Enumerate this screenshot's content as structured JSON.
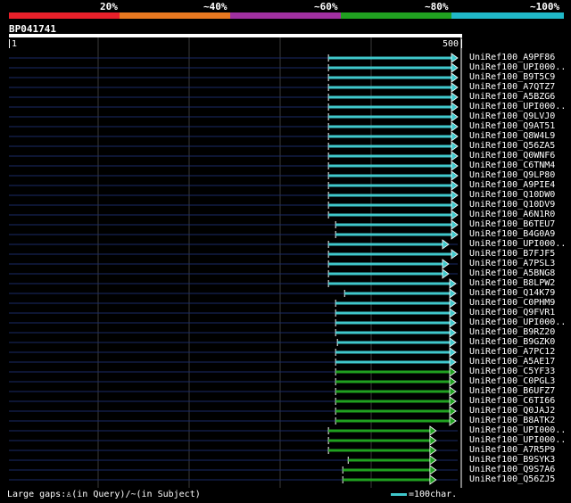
{
  "legend": {
    "labels": [
      "20%",
      "~40%",
      "~60%",
      "~80%",
      "~100%"
    ],
    "colors": [
      "#e8202a",
      "#e87820",
      "#a030a0",
      "#20a020",
      "#20b8c8"
    ]
  },
  "query": {
    "name": "BP041741",
    "start_label": "1",
    "end_label": "500"
  },
  "hits": [
    {
      "label": "UniRef100_A9PF86",
      "start": 356,
      "end": 500,
      "color": "#40c8cc"
    },
    {
      "label": "UniRef100_UPI000..",
      "start": 356,
      "end": 500,
      "color": "#40c8cc"
    },
    {
      "label": "UniRef100_B9T5C9",
      "start": 356,
      "end": 500,
      "color": "#40c8cc"
    },
    {
      "label": "UniRef100_A7QTZ7",
      "start": 356,
      "end": 500,
      "color": "#40c8cc"
    },
    {
      "label": "UniRef100_A5BZG6",
      "start": 356,
      "end": 500,
      "color": "#40c8cc"
    },
    {
      "label": "UniRef100_UPI000..",
      "start": 356,
      "end": 500,
      "color": "#40c8cc"
    },
    {
      "label": "UniRef100_Q9LVJ0",
      "start": 356,
      "end": 500,
      "color": "#40c8cc"
    },
    {
      "label": "UniRef100_Q9AT51",
      "start": 356,
      "end": 500,
      "color": "#40c8cc"
    },
    {
      "label": "UniRef100_Q8W4L9",
      "start": 356,
      "end": 500,
      "color": "#40c8cc"
    },
    {
      "label": "UniRef100_Q56ZA5",
      "start": 356,
      "end": 500,
      "color": "#40c8cc"
    },
    {
      "label": "UniRef100_Q0WNF6",
      "start": 356,
      "end": 500,
      "color": "#40c8cc"
    },
    {
      "label": "UniRef100_C6TNM4",
      "start": 356,
      "end": 500,
      "color": "#40c8cc"
    },
    {
      "label": "UniRef100_Q9LP80",
      "start": 356,
      "end": 500,
      "color": "#40c8cc"
    },
    {
      "label": "UniRef100_A9PIE4",
      "start": 356,
      "end": 500,
      "color": "#40c8cc"
    },
    {
      "label": "UniRef100_Q10DW0",
      "start": 356,
      "end": 500,
      "color": "#40c8cc"
    },
    {
      "label": "UniRef100_Q10DV9",
      "start": 356,
      "end": 500,
      "color": "#40c8cc"
    },
    {
      "label": "UniRef100_A6N1R0",
      "start": 356,
      "end": 500,
      "color": "#40c8cc"
    },
    {
      "label": "UniRef100_B6TEU7",
      "start": 364,
      "end": 500,
      "color": "#40c8cc"
    },
    {
      "label": "UniRef100_B4G0A9",
      "start": 364,
      "end": 500,
      "color": "#40c8cc"
    },
    {
      "label": "UniRef100_UPI000..",
      "start": 356,
      "end": 490,
      "color": "#40c8cc"
    },
    {
      "label": "UniRef100_B7FJF5",
      "start": 356,
      "end": 500,
      "color": "#40c8cc"
    },
    {
      "label": "UniRef100_A7PSL3",
      "start": 356,
      "end": 490,
      "color": "#40c8cc"
    },
    {
      "label": "UniRef100_A5BNG8",
      "start": 356,
      "end": 490,
      "color": "#40c8cc"
    },
    {
      "label": "UniRef100_B8LPW2",
      "start": 356,
      "end": 498,
      "color": "#40c8cc"
    },
    {
      "label": "UniRef100_Q14K79",
      "start": 374,
      "end": 498,
      "color": "#40c8cc"
    },
    {
      "label": "UniRef100_C0PHM9",
      "start": 364,
      "end": 498,
      "color": "#40c8cc"
    },
    {
      "label": "UniRef100_Q9FVR1",
      "start": 364,
      "end": 498,
      "color": "#40c8cc"
    },
    {
      "label": "UniRef100_UPI000..",
      "start": 364,
      "end": 498,
      "color": "#40c8cc"
    },
    {
      "label": "UniRef100_B9RZ20",
      "start": 364,
      "end": 498,
      "color": "#40c8cc"
    },
    {
      "label": "UniRef100_B9GZK0",
      "start": 366,
      "end": 498,
      "color": "#40c8cc"
    },
    {
      "label": "UniRef100_A7PC12",
      "start": 364,
      "end": 498,
      "color": "#40c8cc"
    },
    {
      "label": "UniRef100_A5AE17",
      "start": 364,
      "end": 498,
      "color": "#40c8cc"
    },
    {
      "label": "UniRef100_C5YF33",
      "start": 364,
      "end": 498,
      "color": "#20a020"
    },
    {
      "label": "UniRef100_C0PGL3",
      "start": 364,
      "end": 498,
      "color": "#20a020"
    },
    {
      "label": "UniRef100_B6UFZ7",
      "start": 364,
      "end": 498,
      "color": "#20a020"
    },
    {
      "label": "UniRef100_C6TI66",
      "start": 364,
      "end": 498,
      "color": "#20a020"
    },
    {
      "label": "UniRef100_Q0JAJ2",
      "start": 364,
      "end": 498,
      "color": "#20a020"
    },
    {
      "label": "UniRef100_B8ATK2",
      "start": 364,
      "end": 498,
      "color": "#20a020"
    },
    {
      "label": "UniRef100_UPI000..",
      "start": 356,
      "end": 476,
      "color": "#20a020"
    },
    {
      "label": "UniRef100_UPI000..",
      "start": 356,
      "end": 476,
      "color": "#20a020"
    },
    {
      "label": "UniRef100_A7R5P9",
      "start": 356,
      "end": 476,
      "color": "#20a020"
    },
    {
      "label": "UniRef100_B9SYK3",
      "start": 378,
      "end": 476,
      "color": "#20a020"
    },
    {
      "label": "UniRef100_Q9S7A6",
      "start": 372,
      "end": 476,
      "color": "#20a020"
    },
    {
      "label": "UniRef100_Q56ZJ5",
      "start": 372,
      "end": 476,
      "color": "#20a020"
    }
  ],
  "footer": {
    "note": "Large gaps:♙(in Query)/~(in Subject)",
    "scale": "=100char."
  }
}
